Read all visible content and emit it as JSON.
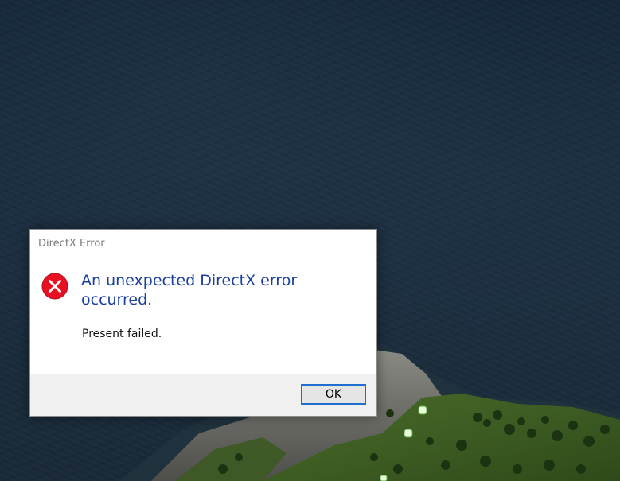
{
  "dialog": {
    "title": "DirectX Error",
    "main_instruction": "An unexpected DirectX error occurred.",
    "content": "Present failed.",
    "ok_label": "OK",
    "icon": "error-icon"
  },
  "colors": {
    "instruction": "#1a3fa0",
    "error_icon": "#e81123",
    "water": "#1a2c40",
    "button_focus": "#1f6fd1"
  }
}
